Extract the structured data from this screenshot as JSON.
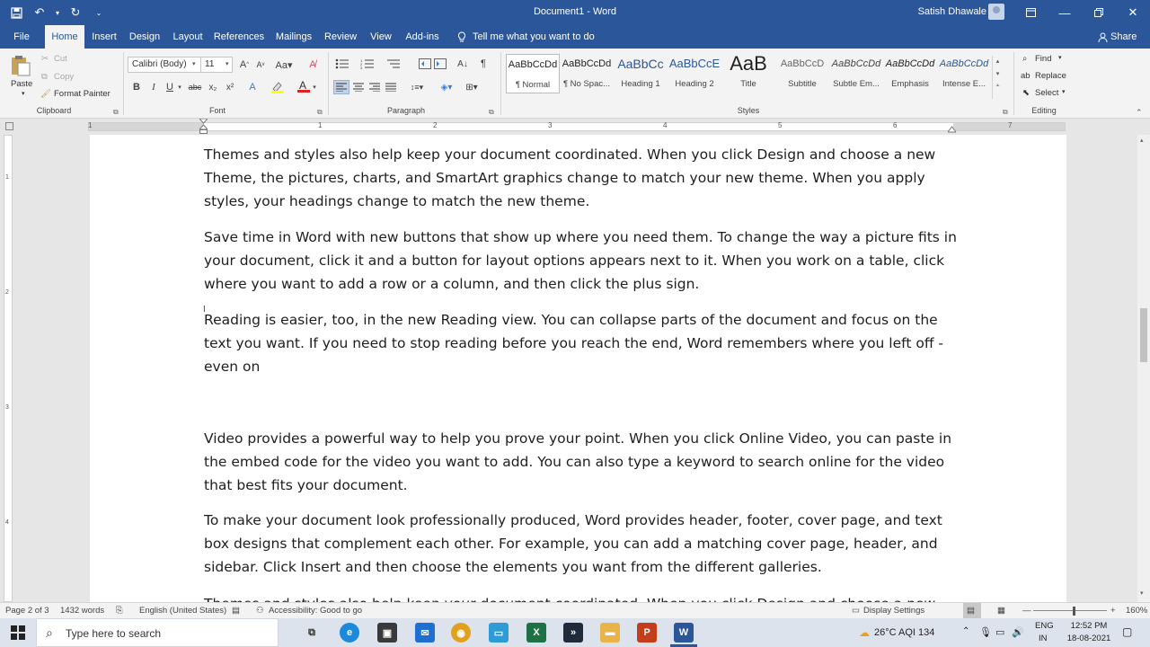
{
  "titlebar": {
    "doc_title": "Document1  -  Word",
    "user_name": "Satish Dhawale"
  },
  "tabs": [
    "File",
    "Home",
    "Insert",
    "Design",
    "Layout",
    "References",
    "Mailings",
    "Review",
    "View",
    "Add-ins"
  ],
  "tell_me": "Tell me what you want to do",
  "share": "Share",
  "clipboard": {
    "paste": "Paste",
    "cut": "Cut",
    "copy": "Copy",
    "format_painter": "Format Painter",
    "label": "Clipboard"
  },
  "font": {
    "family": "Calibri (Body)",
    "size": "11",
    "label": "Font"
  },
  "paragraph": {
    "label": "Paragraph"
  },
  "styles": {
    "label": "Styles",
    "items": [
      {
        "sample": "AaBbCcDd",
        "name": "¶ Normal"
      },
      {
        "sample": "AaBbCcDd",
        "name": "¶ No Spac..."
      },
      {
        "sample": "AaBbCc",
        "name": "Heading 1"
      },
      {
        "sample": "AaBbCcE",
        "name": "Heading 2"
      },
      {
        "sample": "AaB",
        "name": "Title"
      },
      {
        "sample": "AaBbCcD",
        "name": "Subtitle"
      },
      {
        "sample": "AaBbCcDd",
        "name": "Subtle Em..."
      },
      {
        "sample": "AaBbCcDd",
        "name": "Emphasis"
      },
      {
        "sample": "AaBbCcDd",
        "name": "Intense E..."
      }
    ]
  },
  "editing": {
    "find": "Find",
    "replace": "Replace",
    "select": "Select",
    "label": "Editing"
  },
  "ruler_numbers": [
    "1",
    "1",
    "2",
    "3",
    "4",
    "5",
    "6",
    "7"
  ],
  "vruler_numbers": [
    "1",
    "2",
    "3",
    "4"
  ],
  "document": {
    "paragraphs": [
      "Themes and styles also help keep your document coordinated. When you click Design and choose a new Theme, the pictures, charts, and SmartArt graphics change to match your new theme. When you apply styles, your headings change to match the new theme.",
      "Save time in Word with new buttons that show up where you need them. To change the way a picture fits in your document, click it and a button for layout options appears next to it. When you work on a table, click where you want to add a row or a column, and then click the plus sign.",
      "Reading is easier, too, in the new Reading view. You can collapse parts of the document and focus on the text you want. If you need to stop reading before you reach the end, Word remembers where you left off - even on",
      "Video provides a powerful way to help you prove your point. When you click Online Video, you can paste in the embed code for the video you want to add. You can also type a keyword to search online for the video that best fits your document.",
      "To make your document look professionally produced, Word provides header, footer, cover page, and text box designs that complement each other. For example, you can add a matching cover page, header, and sidebar. Click Insert and then choose the elements you want from the different galleries.",
      "Themes and styles also help keep your document coordinated. When you click Design and choose a new"
    ]
  },
  "status": {
    "page": "Page 2 of 3",
    "words": "1432 words",
    "language": "English (United States)",
    "accessibility": "Accessibility: Good to go",
    "display_settings": "Display Settings",
    "zoom": "160%"
  },
  "taskbar": {
    "search_placeholder": "Type here to search",
    "weather": "26°C  AQI 134",
    "lang": "ENG",
    "region": "IN",
    "time": "12:52 PM",
    "date": "18-08-2021"
  }
}
